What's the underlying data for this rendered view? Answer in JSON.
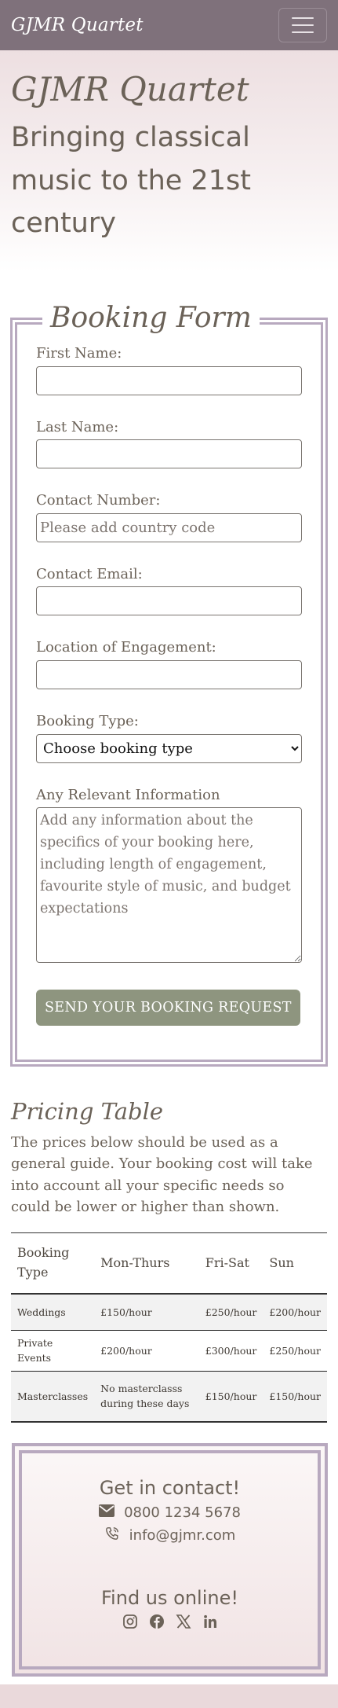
{
  "navbar": {
    "brand": "GJMR Quartet",
    "toggler_icon": "hamburger-icon"
  },
  "hero": {
    "title": "GJMR Quartet",
    "tagline": "Bringing classical music to the 21st century"
  },
  "booking": {
    "legend": "Booking Form",
    "first_name": {
      "label": "First Name:",
      "value": "",
      "placeholder": ""
    },
    "last_name": {
      "label": "Last Name:",
      "value": "",
      "placeholder": ""
    },
    "contact_number": {
      "label": "Contact Number:",
      "value": "",
      "placeholder": "Please add country code"
    },
    "contact_email": {
      "label": "Contact Email:",
      "value": "",
      "placeholder": ""
    },
    "location": {
      "label": "Location of Engagement:",
      "value": "",
      "placeholder": ""
    },
    "booking_type": {
      "label": "Booking Type:",
      "selected": "Choose booking type"
    },
    "info": {
      "label": "Any Relevant Information",
      "placeholder": "Add any information about the specifics of your booking here, including length of engagement, favourite style of music, and budget expectations"
    },
    "submit_label": "SEND YOUR BOOKING REQUEST"
  },
  "pricing": {
    "title": "Pricing Table",
    "intro": "The prices below should be used as a general guide. Your booking cost will take into account all your specific needs so could be lower or higher than shown.",
    "headers": [
      "Booking Type",
      "Mon-Thurs",
      "Fri-Sat",
      "Sun"
    ],
    "rows": [
      [
        "Weddings",
        "£150/hour",
        "£250/hour",
        "£200/hour"
      ],
      [
        "Private Events",
        "£200/hour",
        "£300/hour",
        "£250/hour"
      ],
      [
        "Masterclasses",
        "No masterclasss during these days",
        "£150/hour",
        "£150/hour"
      ]
    ]
  },
  "contact": {
    "heading": "Get in contact!",
    "phone": "0800 1234 5678",
    "email": "info@gjmr.com",
    "phone_icon": "envelope-icon",
    "email_icon": "phone-icon",
    "online_heading": "Find us online!",
    "social_icons": [
      "instagram-icon",
      "facebook-icon",
      "x-icon",
      "linkedin-icon"
    ]
  },
  "colors": {
    "navbar": "#7f717b",
    "accent_border": "#b8a9bf",
    "button": "#8e957f",
    "text": "#6b6258"
  }
}
